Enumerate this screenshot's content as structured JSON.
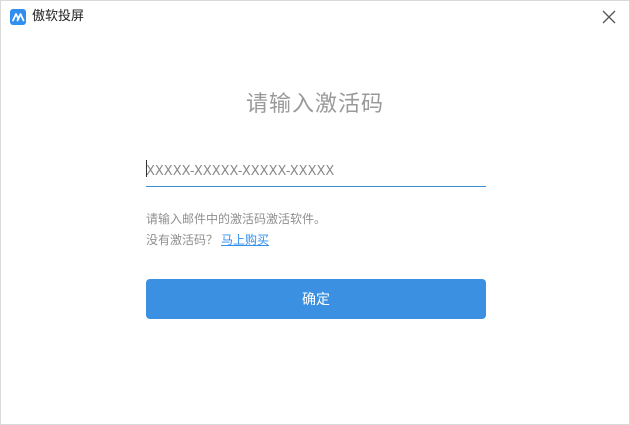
{
  "window": {
    "app_title": "傲软投屏",
    "app_icon": "aowsoft-logo-icon",
    "close_icon": "close-icon"
  },
  "activation": {
    "heading": "请输入激活码",
    "code_input": {
      "value": "",
      "placeholder": "XXXXX-XXXXX-XXXXX-XXXXX"
    },
    "hint": "请输入邮件中的激活码激活软件。",
    "no_code_label": "没有激活码？",
    "buy_link": "马上购买",
    "confirm_button": "确定"
  },
  "colors": {
    "accent": "#3b90e2",
    "link": "#2f8ef0",
    "input_underline": "#3d8fd8",
    "muted_text": "#8f8f8f",
    "heading_text": "#9a9a9a"
  }
}
